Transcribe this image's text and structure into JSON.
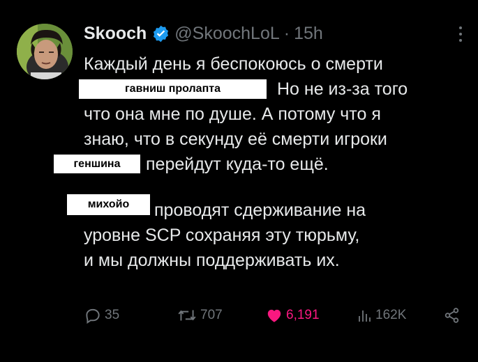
{
  "author": {
    "display_name": "Skooch",
    "verified_icon": "verified-badge-icon",
    "handle": "@SkoochLoL",
    "separator": "·",
    "time": "15h"
  },
  "tweet": {
    "lines": [
      "Каждый день я беспокоюсь о смерти",
      "Но не из-за того",
      "что она мне по душе. А потому что я",
      "знаю, что в секунду её смерти игроки",
      "перейдут куда-то ещё.",
      "проводят сдерживание на",
      "уровне SCP сохраняя эту тюрьму,",
      "и мы должны поддерживать их."
    ],
    "redactions": [
      "гавниш пролапта",
      "геншина",
      "михойо"
    ]
  },
  "actions": {
    "replies": "35",
    "reposts": "707",
    "likes": "6,191",
    "views": "162K"
  },
  "colors": {
    "background": "#000000",
    "text": "#e7e9ea",
    "secondary": "#71767b",
    "verified": "#1d9bf0",
    "like": "#f91880"
  }
}
